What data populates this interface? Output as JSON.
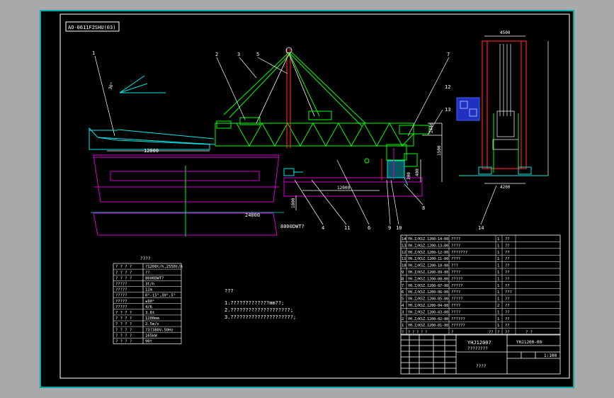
{
  "title_tag": "AO-0611F2SHU(03)",
  "callouts": [
    "1",
    "2",
    "3",
    "5",
    "7",
    "12",
    "13",
    "4",
    "11",
    "6",
    "9",
    "10",
    "8",
    "14"
  ],
  "dims": {
    "boom_len": "12000",
    "hull_len": "24000",
    "rail_len": "12000",
    "h_2440": "2440",
    "h_1500": "1500",
    "h_400": "400",
    "h_300": "300",
    "h_1800": "1800",
    "w_top": "4500",
    "w_bottom": "4200",
    "angle": "30°",
    "barge": "8000DWT?"
  },
  "params": {
    "title": "????",
    "rows": [
      {
        "k": "? ? ? ?",
        "v": "?1200t/h,2550t/h"
      },
      {
        "k": "? ? ? ?",
        "v": "??"
      },
      {
        "k": "? ? ? ?",
        "v": "8000DWT?"
      },
      {
        "k": "?????",
        "v": "3t/h"
      },
      {
        "k": "?????",
        "v": "12m"
      },
      {
        "k": "?????",
        "v": "0°-15°,30°,5°"
      },
      {
        "k": "?????",
        "v": "±90°"
      },
      {
        "k": "?????",
        "v": "4/6"
      },
      {
        "k": "? ? ? ?",
        "v": "3.8t"
      },
      {
        "k": "? ? ? ?",
        "v": "1200mm"
      },
      {
        "k": "? ? ? ?",
        "v": "2.5m/s"
      },
      {
        "k": "? ? ? ?",
        "v": "?3?380V,50Hz"
      },
      {
        "k": "? ? ? ?",
        "v": "165kW"
      },
      {
        "k": "? ? ? ?",
        "v": "90t"
      }
    ]
  },
  "notes": {
    "title": "???",
    "lines": [
      "1.?????????????mm??;",
      "2.????????????????????;",
      "3.?????????????????????;"
    ]
  },
  "parts": {
    "rows": [
      {
        "n": "14",
        "code": "YH.Z/KSZ.1200-14-00",
        "name": "????",
        "q": "1",
        "m": "??"
      },
      {
        "n": "13",
        "code": "YH.Z/KSZ.1200-13-00",
        "name": "????",
        "q": "1",
        "m": "??"
      },
      {
        "n": "12",
        "code": "YH.Z/KSZ.1200-12-00",
        "name": "???????",
        "q": "1",
        "m": "??"
      },
      {
        "n": "11",
        "code": "YH.Z/KSZ.1200-11-00",
        "name": "????",
        "q": "1",
        "m": "??"
      },
      {
        "n": "10",
        "code": "YH.Z/KSZ.1200-10-00",
        "name": "???",
        "q": "1",
        "m": "??"
      },
      {
        "n": "9",
        "code": "YH.Z/KSZ.1200-09-00",
        "name": "????",
        "q": "1",
        "m": "??"
      },
      {
        "n": "8",
        "code": "YH.Z/KSZ.1200-08-00",
        "name": "?????",
        "q": "1",
        "m": "??"
      },
      {
        "n": "7",
        "code": "YH.Z/KSZ.1200-07-00",
        "name": "?????",
        "q": "1",
        "m": "??"
      },
      {
        "n": "6",
        "code": "YH.Z/KSZ.1200-06-00",
        "name": "????",
        "q": "1",
        "m": "???"
      },
      {
        "n": "5",
        "code": "YH.Z/KSZ.1200-05-00",
        "name": "?????",
        "q": "1",
        "m": "??"
      },
      {
        "n": "4",
        "code": "YH.Z/KSZ.1200-04-00",
        "name": "????",
        "q": "2",
        "m": "??"
      },
      {
        "n": "3",
        "code": "YH.Z/KSZ.1200-03-00",
        "name": "????",
        "q": "1",
        "m": "??"
      },
      {
        "n": "2",
        "code": "YH.Z/KSZ.1200-02-00",
        "name": "??????",
        "q": "1",
        "m": "??"
      },
      {
        "n": "1",
        "code": "YH.Z/KSZ.1200-01-00",
        "name": "??????",
        "q": "1",
        "m": "??"
      }
    ],
    "header": {
      "n": "?",
      "code": "? ? ? ? ?",
      "name": "?",
      "q": "?",
      "w1": "??",
      "m": "??",
      "note": "? ?"
    }
  },
  "titleblock": {
    "name": "YHJ1200?",
    "sub": "????????",
    "drawing_no": "YHJ1200-00",
    "scale": "1:100",
    "company": "????"
  }
}
